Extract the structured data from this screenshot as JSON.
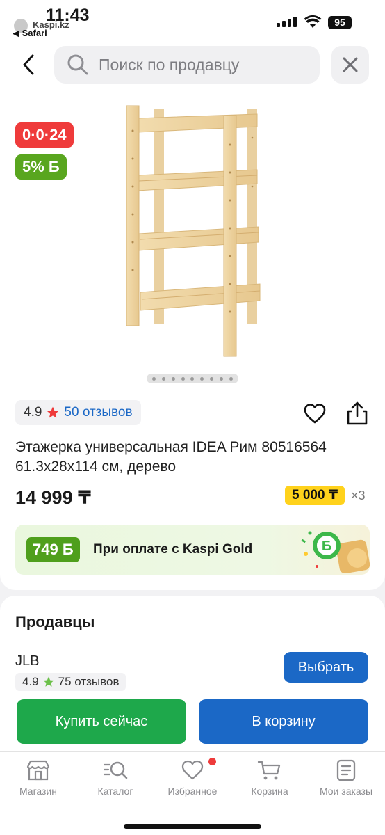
{
  "status_bar": {
    "time": "11:43",
    "domain": "Kaspi.kz",
    "back_app": "◀ Safari",
    "battery": "95"
  },
  "search": {
    "placeholder": "Поиск по продавцу"
  },
  "product": {
    "timer_badge": "0·0·24",
    "bonus_badge": "5% Б",
    "rating_value": "4.9",
    "reviews_link": "50 отзывов",
    "title": "Этажерка универсальная IDEA Рим 80516564 61.3x28x114 см, дерево",
    "price": "14 999 ₸",
    "installment": "5 000 ₸",
    "installment_times": "×3",
    "image_dots_count": 9
  },
  "kaspi_gold": {
    "badge": "749 Б",
    "text": "При оплате с Kaspi Gold"
  },
  "sellers": {
    "title": "Продавцы",
    "seller_name": "JLB",
    "seller_rating": "4.9",
    "seller_reviews": "75 отзывов",
    "select_label": "Выбрать",
    "buy_now_label": "Купить сейчас",
    "add_to_cart_label": "В корзину"
  },
  "bottom_nav": {
    "items": [
      {
        "label": "Магазин",
        "icon": "store-icon"
      },
      {
        "label": "Каталог",
        "icon": "catalog-search-icon"
      },
      {
        "label": "Избранное",
        "icon": "heart-icon"
      },
      {
        "label": "Корзина",
        "icon": "cart-icon"
      },
      {
        "label": "Мои заказы",
        "icon": "orders-icon"
      }
    ]
  },
  "colors": {
    "accent_blue": "#1b68c6",
    "buy_green": "#1ea84b",
    "timer_red": "#ef3b3b",
    "bonus_green": "#59a61f",
    "installment_yellow": "#ffd21c"
  }
}
